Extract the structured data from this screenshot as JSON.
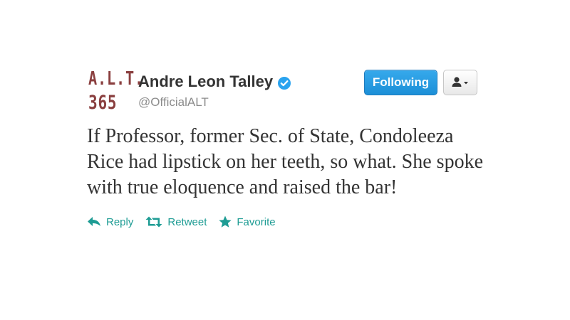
{
  "user": {
    "avatar_line1": "A.L.T.",
    "avatar_line2": "365",
    "full_name": "Andre Leon Talley",
    "handle": "@OfficialALT",
    "verified": true
  },
  "buttons": {
    "follow_label": "Following",
    "user_menu_icon": "user-dropdown-icon"
  },
  "tweet": {
    "text": "If Professor, former Sec. of State, Condoleeza Rice had lipstick on her teeth, so what. She spoke with true eloquence and raised the bar!"
  },
  "actions": {
    "reply_label": "Reply",
    "retweet_label": "Retweet",
    "favorite_label": "Favorite"
  },
  "colors": {
    "avatar_text": "#8a3f3f",
    "follow_button": "#1c8fd7",
    "action_teal": "#1e9c94",
    "verified_blue": "#2aa3ef"
  }
}
